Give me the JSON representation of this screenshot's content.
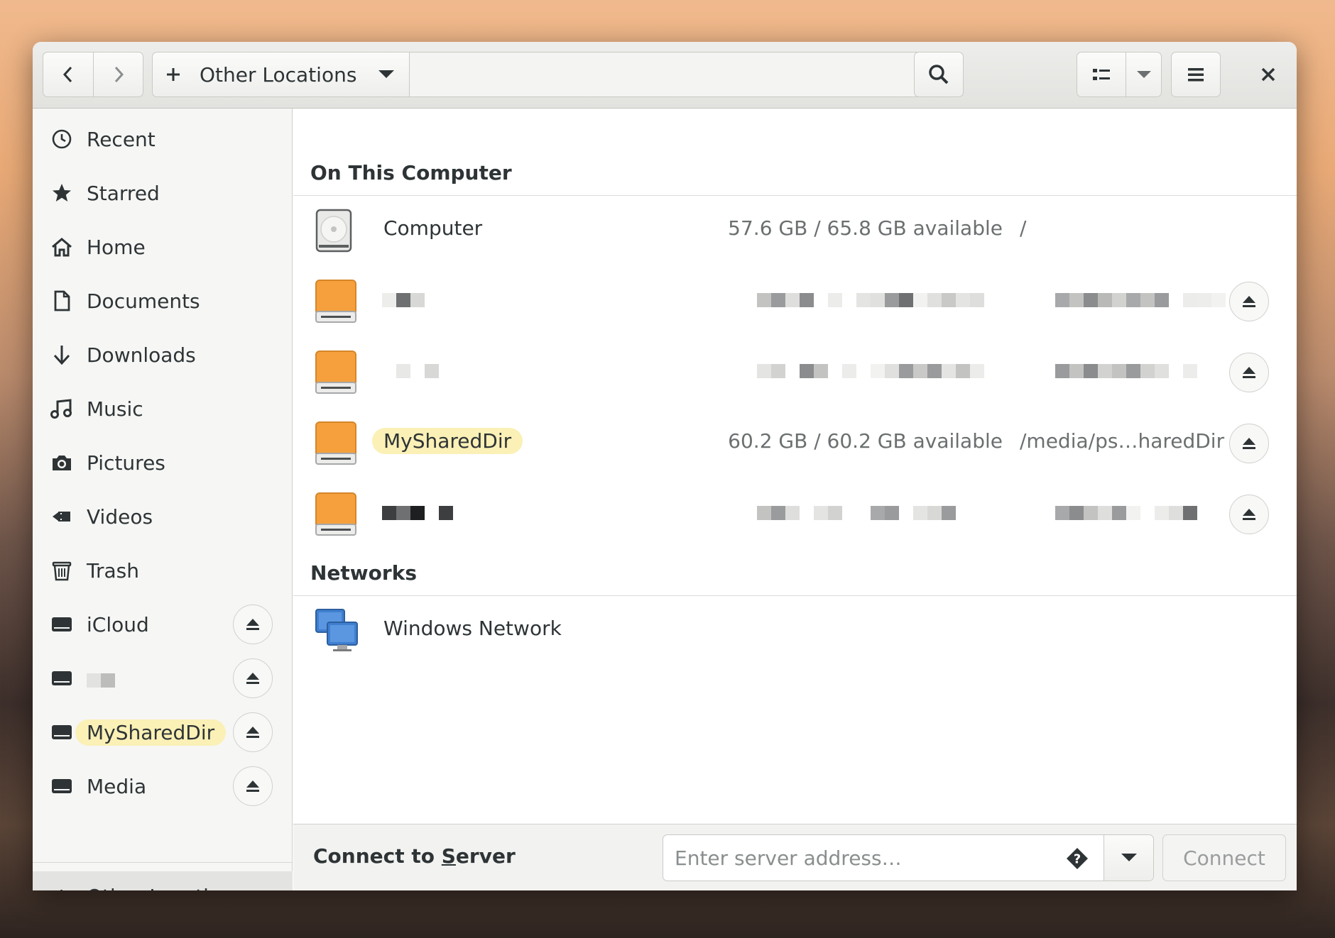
{
  "header": {
    "location_label": "Other Locations",
    "icons": [
      "back-icon",
      "forward-icon",
      "plus-icon",
      "chevron-down-icon",
      "search-icon",
      "list-view-icon",
      "menu-icon",
      "close-icon"
    ]
  },
  "sidebar": {
    "items": [
      {
        "label": "Recent",
        "icon": "clock-icon"
      },
      {
        "label": "Starred",
        "icon": "star-icon"
      },
      {
        "label": "Home",
        "icon": "home-icon"
      },
      {
        "label": "Documents",
        "icon": "document-icon"
      },
      {
        "label": "Downloads",
        "icon": "download-icon"
      },
      {
        "label": "Music",
        "icon": "music-icon"
      },
      {
        "label": "Pictures",
        "icon": "camera-icon"
      },
      {
        "label": "Videos",
        "icon": "video-icon"
      },
      {
        "label": "Trash",
        "icon": "trash-icon"
      }
    ],
    "mounts": [
      {
        "label": "iCloud",
        "icon": "drive-icon"
      },
      {
        "label": "",
        "icon": "drive-icon"
      },
      {
        "label": "MySharedDir",
        "icon": "drive-icon",
        "highlighted": true
      },
      {
        "label": "Media",
        "icon": "drive-icon"
      }
    ],
    "other_locations": "Other Locations"
  },
  "main": {
    "on_this_computer": "On This Computer",
    "computer": {
      "name": "Computer",
      "capacity": "57.6 GB / 65.8 GB available",
      "path": "/"
    },
    "shared": {
      "name": "MySharedDir",
      "capacity": "60.2 GB / 60.2 GB available",
      "path": "/media/ps…haredDir"
    },
    "networks": "Networks",
    "windows_network": "Windows Network"
  },
  "bottom": {
    "connect_to_server_pre": "Connect to ",
    "connect_to_server_u": "S",
    "connect_to_server_post": "erver",
    "server_placeholder": "Enter server address…",
    "connect_label": "Connect"
  },
  "colors": {
    "accent_drive": "#f5a03c",
    "highlight": "#fbf0b6",
    "network_blue": "#3f7fd0"
  }
}
